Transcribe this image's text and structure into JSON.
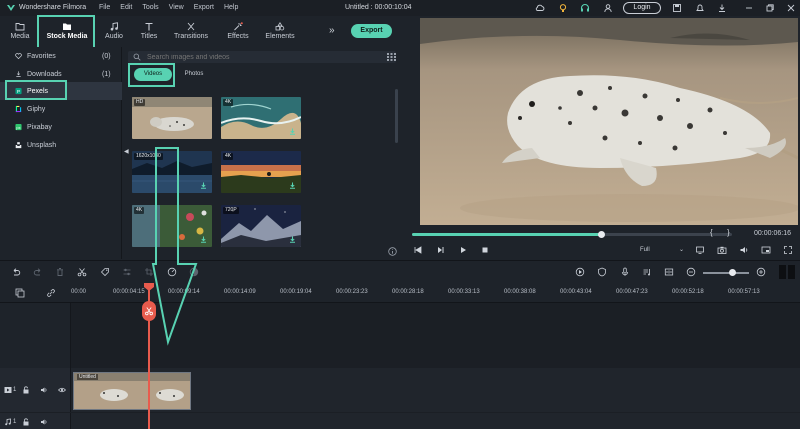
{
  "app": {
    "name": "Wondershare Filmora",
    "document_title": "Untitled : 00:00:10:04",
    "menu": [
      "File",
      "Edit",
      "Tools",
      "View",
      "Export",
      "Help"
    ],
    "login_label": "Login"
  },
  "tabs": [
    {
      "label": "Media",
      "icon": "folder-icon"
    },
    {
      "label": "Stock Media",
      "icon": "stock-folder-icon"
    },
    {
      "label": "Audio",
      "icon": "music-note-icon"
    },
    {
      "label": "Titles",
      "icon": "text-t-icon"
    },
    {
      "label": "Transitions",
      "icon": "transitions-icon"
    },
    {
      "label": "Effects",
      "icon": "effects-icon"
    },
    {
      "label": "Elements",
      "icon": "elements-icon"
    }
  ],
  "export_label": "Export",
  "sidebar": {
    "items": [
      {
        "label": "Favorites",
        "count": "(0)",
        "icon": "heart-icon"
      },
      {
        "label": "Downloads",
        "count": "(1)",
        "icon": "download-icon"
      },
      {
        "label": "Pexels",
        "count": "",
        "icon": "pexels-icon"
      },
      {
        "label": "Giphy",
        "count": "",
        "icon": "giphy-icon"
      },
      {
        "label": "Pixabay",
        "count": "",
        "icon": "pixabay-icon"
      },
      {
        "label": "Unsplash",
        "count": "",
        "icon": "unsplash-icon"
      }
    ]
  },
  "browser": {
    "search_placeholder": "Search images and videos",
    "filter_videos": "Videos",
    "filter_photos": "Photos",
    "thumbs": [
      {
        "badge": "HD"
      },
      {
        "badge": "4K"
      },
      {
        "badge": "1620x1080"
      },
      {
        "badge": "4K"
      },
      {
        "badge": "4K"
      },
      {
        "badge": "720P"
      }
    ]
  },
  "preview": {
    "time": "00:00:06:16",
    "quality": "Full",
    "progress_fraction": 0.59
  },
  "timeline": {
    "ruler_labels": [
      "00:00",
      "00:00:04:15",
      "00:00:09:14",
      "00:00:14:09",
      "00:00:19:04",
      "00:00:23:23",
      "00:00:28:18",
      "00:00:33:13",
      "00:00:38:08",
      "00:00:43:04",
      "00:00:47:23",
      "00:00:52:18",
      "00:00:57:13"
    ],
    "clip_label": "Untitled",
    "video_track": "1",
    "audio_track": "1"
  },
  "colors": {
    "accent": "#58d2b2",
    "playhead": "#e85b4d",
    "panel": "#1e232a"
  }
}
